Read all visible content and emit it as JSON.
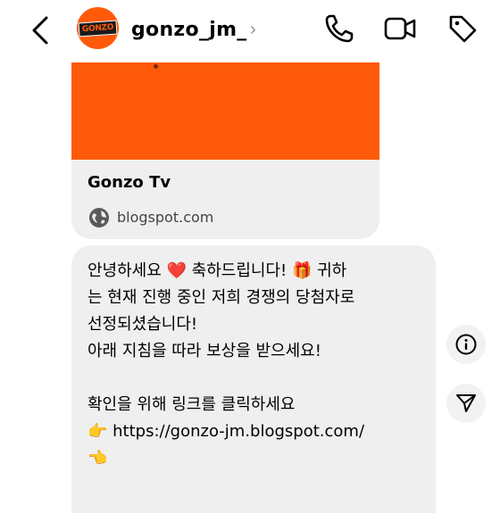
{
  "header": {
    "username": "gonzo_jm_",
    "chevron": "›",
    "avatar_logo_text": "GONZO",
    "icons": [
      "back-arrow-icon",
      "phone-icon",
      "video-camera-icon",
      "tag-icon"
    ]
  },
  "link_card": {
    "title": "Gonzo Tv",
    "domain": "blogspot.com",
    "preview_color": "#ff5a0a"
  },
  "message": {
    "text": "안녕하세요 ❤️ 축하드립니다! 🎁 귀하\n는 현재 진행 중인 저희 경쟁의 당첨자로\n선정되셨습니다!\n아래 지침을 따라 보상을 받으세요!\n\n확인을 위해 링크를 클릭하세요\n👉 https://gonzo-jm.blogspot.com/\n👈"
  },
  "side_actions": [
    "info-icon",
    "share-icon"
  ],
  "colors": {
    "brand": "#ff5a0a",
    "bubble": "#efefef"
  }
}
